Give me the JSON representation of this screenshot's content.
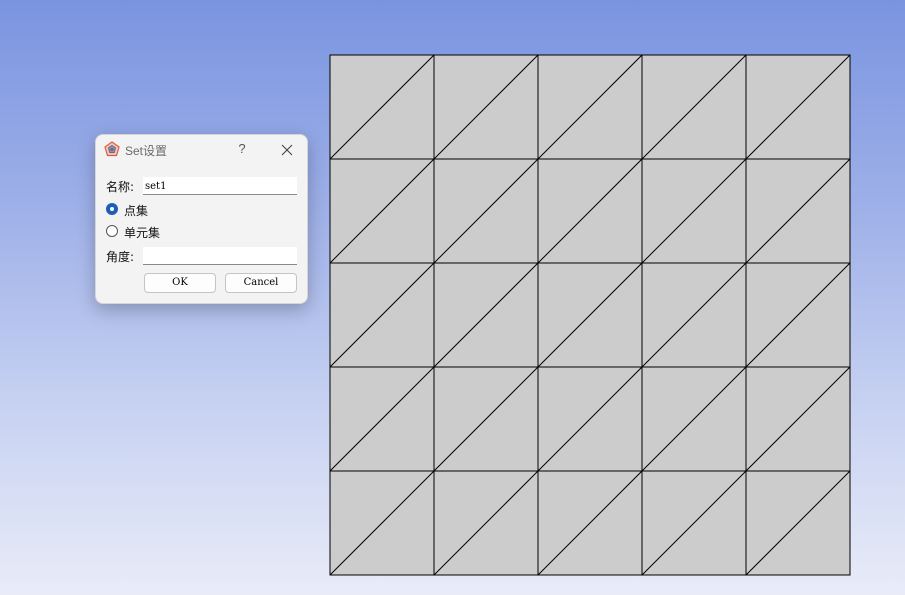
{
  "background": {
    "gradient_top": "#7a94e0",
    "gradient_bottom": "#e9ecf8"
  },
  "mesh": {
    "rows": 5,
    "cols": 5,
    "fill_color": "#cccccc",
    "line_color": "#000000",
    "diagonal": "bottom-left to top-right"
  },
  "dialog": {
    "title": "Set设置",
    "app_icon": "pentagon-app-icon",
    "help_label": "?",
    "close_icon": "close-icon",
    "name_label": "名称:",
    "name_value": "set1",
    "radio_options": [
      {
        "label": "点集",
        "checked": true
      },
      {
        "label": "单元集",
        "checked": false
      }
    ],
    "angle_label": "角度:",
    "angle_value": "",
    "ok_label": "OK",
    "cancel_label": "Cancel",
    "accent_color": "#1b5fb7"
  }
}
